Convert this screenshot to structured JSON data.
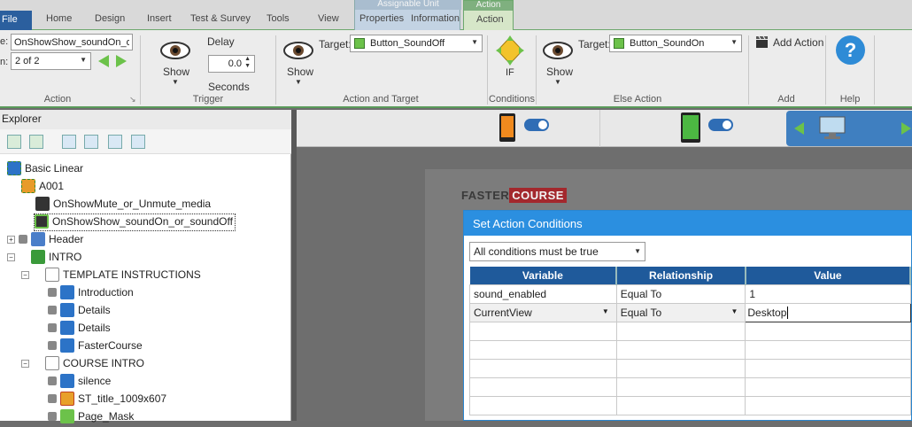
{
  "tabs": {
    "file": "File",
    "home": "Home",
    "design": "Design",
    "insert": "Insert",
    "test_survey": "Test & Survey",
    "tools": "Tools",
    "view": "View",
    "assignable_group": "Assignable Unit",
    "properties": "Properties",
    "information": "Information",
    "action_group": "Action",
    "action": "Action"
  },
  "ribbon": {
    "action_name_label": "e:",
    "action_name_value": "OnShowShow_soundOn_or",
    "action_index_label": "n:",
    "action_index_value": "2 of 2",
    "group_action": "Action",
    "trigger_show": "Show",
    "delay_label": "Delay",
    "delay_value": "0.0",
    "seconds_label": "Seconds",
    "group_trigger": "Trigger",
    "target_show": "Show",
    "target_label": "Target:",
    "target_value": "Button_SoundOff",
    "group_action_target": "Action and Target",
    "if_label": "IF",
    "group_conditions": "Conditions",
    "else_show": "Show",
    "else_target_label": "Target:",
    "else_target_value": "Button_SoundOn",
    "group_else": "Else Action",
    "add_action": "Add Action",
    "group_add": "Add",
    "group_help": "Help",
    "help_symbol": "?"
  },
  "explorer": {
    "title": "Explorer",
    "tree": [
      {
        "label": "Basic Linear",
        "icon": "project-icon"
      },
      {
        "label": "A001",
        "icon": "unit-icon"
      },
      {
        "label": "OnShowMute_or_Unmute_media",
        "icon": "clapper-icon"
      },
      {
        "label": "OnShowShow_soundOn_or_soundOff",
        "icon": "clapper-icon"
      },
      {
        "label": "Header",
        "icon": "layers-icon"
      },
      {
        "label": "INTRO",
        "icon": "book-icon"
      },
      {
        "label": "TEMPLATE INSTRUCTIONS",
        "icon": "page-icon"
      },
      {
        "label": "Introduction",
        "icon": "text-icon"
      },
      {
        "label": "Details",
        "icon": "text-icon"
      },
      {
        "label": "Details",
        "icon": "text-icon"
      },
      {
        "label": "FasterCourse",
        "icon": "text-icon"
      },
      {
        "label": "COURSE INTRO",
        "icon": "page-icon"
      },
      {
        "label": "silence",
        "icon": "audio-icon"
      },
      {
        "label": "ST_title_1009x607",
        "icon": "image-icon"
      },
      {
        "label": "Page_Mask",
        "icon": "shape-icon"
      }
    ]
  },
  "logo": {
    "part1": "FASTER",
    "part2": "COURSE"
  },
  "dialog": {
    "title": "Set Action Conditions",
    "mode_value": "All conditions must be true",
    "columns": [
      "Variable",
      "Relationship",
      "Value"
    ],
    "rows": [
      {
        "variable": "sound_enabled",
        "relationship": "Equal To",
        "value": "1"
      },
      {
        "variable": "CurrentView",
        "relationship": "Equal To",
        "value": "Desktop"
      }
    ]
  },
  "colors": {
    "accent_blue": "#2b8fe0",
    "header_blue": "#1f5a9b",
    "ribbon_green": "#5a9a5a",
    "logo_red": "#d0343a"
  }
}
